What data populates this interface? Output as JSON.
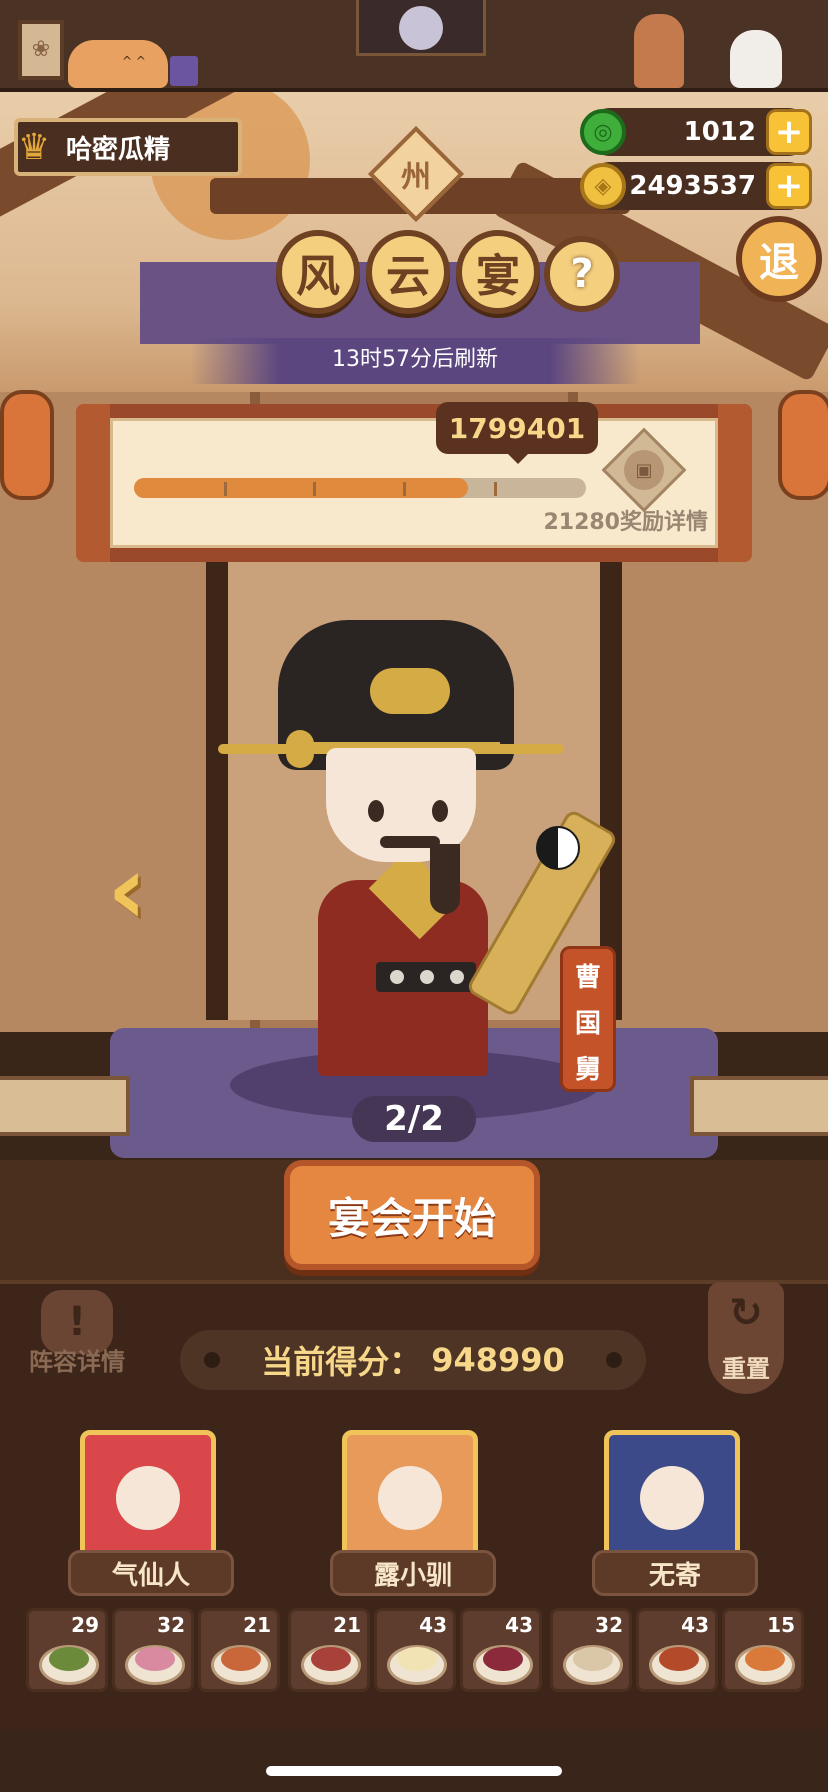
{
  "player": {
    "name": "哈密瓜精"
  },
  "currency": {
    "jade": {
      "icon": "jade-coin-icon",
      "value": "1012"
    },
    "coin": {
      "icon": "copper-coin-icon",
      "value": "2493537"
    },
    "plus": "+"
  },
  "exit_button": {
    "label": "退"
  },
  "title": {
    "region_sign": "州",
    "chars": [
      "风",
      "云",
      "宴"
    ],
    "help": "?",
    "refresh_text": "13时57分后刷新"
  },
  "progress": {
    "target_score": "1799401",
    "fill_fraction": 0.74,
    "reward_text": "21280奖励详情"
  },
  "character": {
    "name_chars": [
      "曹",
      "国",
      "舅"
    ],
    "page": "2/2",
    "prev_arrow": "‹"
  },
  "start_button": {
    "label": "宴会开始"
  },
  "score": {
    "label": "当前得分：",
    "value": "948990"
  },
  "lineup_button": {
    "icon": "!",
    "label": "阵容详情"
  },
  "reset_button": {
    "icon": "↻",
    "label": "重置"
  },
  "heroes": [
    {
      "name": "气仙人",
      "accent": "#d9474a"
    },
    {
      "name": "露小驯",
      "accent": "#e79a5a"
    },
    {
      "name": "无寄",
      "accent": "#3c4a8a"
    }
  ],
  "dishes": [
    {
      "count": "29",
      "color": "#6b8a3a"
    },
    {
      "count": "32",
      "color": "#d98aa0"
    },
    {
      "count": "21",
      "color": "#c9663a"
    },
    {
      "count": "21",
      "color": "#a8413a"
    },
    {
      "count": "43",
      "color": "#f1e3b4"
    },
    {
      "count": "43",
      "color": "#8a2a3a"
    },
    {
      "count": "32",
      "color": "#d9c7a8"
    },
    {
      "count": "43",
      "color": "#b34a2a"
    },
    {
      "count": "15",
      "color": "#d97a3a"
    }
  ]
}
